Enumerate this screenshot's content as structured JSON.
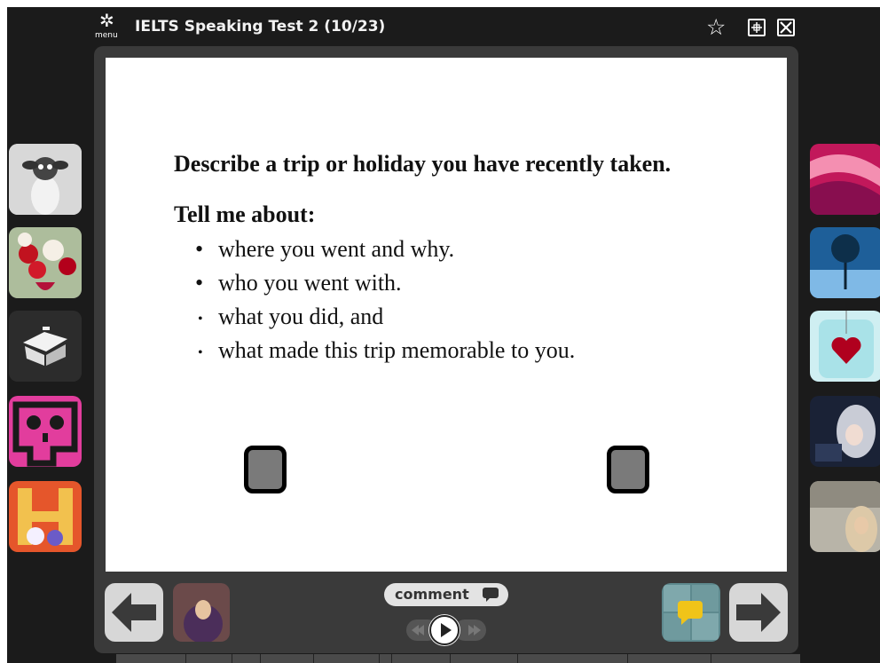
{
  "header": {
    "menu_label": "menu",
    "title": "IELTS Speaking Test 2 (10/23)"
  },
  "icons": {
    "menu": "gear-icon",
    "favorite": "star-icon",
    "fullscreen": "expand-icon",
    "close": "close-icon",
    "prev": "arrow-left-icon",
    "next": "arrow-right-icon",
    "comment": "speech-bubble-icon",
    "play": "play-icon",
    "rewind": "rewind-icon",
    "fast_forward": "fast-forward-icon"
  },
  "slide": {
    "heading": "Describe a trip or holiday you have recently taken.",
    "subheading": "Tell me about:",
    "bullets": [
      "where you went and why.",
      "who you went with.",
      "what you did, and",
      "what made this trip memorable to you."
    ]
  },
  "left_thumbnails": [
    "sheep",
    "roses",
    "home",
    "skull",
    "letter-H"
  ],
  "right_thumbnails": [
    "pink-abstract",
    "underwater-tree",
    "heart-in-water",
    "anime-girl",
    "woman-portrait"
  ],
  "controls": {
    "comment_label": "comment"
  },
  "colors": {
    "background": "#1b1b1b",
    "panel": "#3a3a3a",
    "slide": "#ffffff",
    "accent_yellow": "#f0c419"
  }
}
